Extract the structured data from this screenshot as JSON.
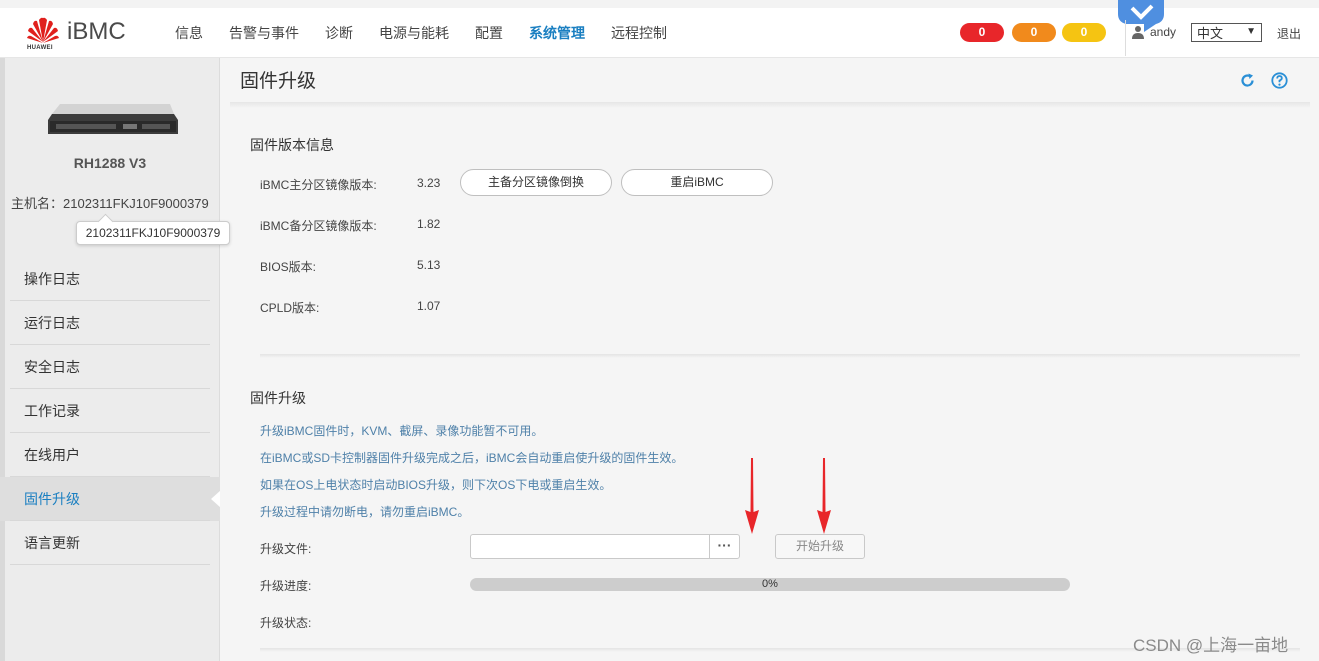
{
  "header": {
    "logo_sub": "HUAWEI",
    "brand": "iBMC",
    "nav": [
      "信息",
      "告警与事件",
      "诊断",
      "电源与能耗",
      "配置",
      "系统管理",
      "远程控制"
    ],
    "nav_active": "系统管理",
    "alarms": {
      "critical": "0",
      "major": "0",
      "minor": "0"
    },
    "alarm_colors": {
      "critical": "#e8262a",
      "major": "#f18a1c",
      "minor": "#f5c412"
    },
    "user": "andy",
    "language": "中文",
    "logout": "退出",
    "accent_color": "#1a7fc1"
  },
  "sidebar": {
    "model": "RH1288 V3",
    "hostname": "主机名：2102311FKJ10F9000379",
    "tooltip": "2102311FKJ10F9000379",
    "menu": [
      "操作日志",
      "运行日志",
      "安全日志",
      "工作记录",
      "在线用户",
      "固件升级",
      "语言更新"
    ],
    "menu_active": "固件升级"
  },
  "main": {
    "title": "固件升级",
    "version_section": {
      "title": "固件版本信息",
      "rows": [
        {
          "label": "iBMC主分区镜像版本:",
          "value": "3.23"
        },
        {
          "label": "iBMC备分区镜像版本:",
          "value": "1.82"
        },
        {
          "label": "BIOS版本:",
          "value": "5.13"
        },
        {
          "label": "CPLD版本:",
          "value": "1.07"
        }
      ],
      "swap_button": "主备分区镜像倒换",
      "restart_button": "重启iBMC"
    },
    "upgrade_section": {
      "title": "固件升级",
      "notes": [
        "升级iBMC固件时，KVM、截屏、录像功能暂不可用。",
        "在iBMC或SD卡控制器固件升级完成之后，iBMC会自动重启使升级的固件生效。",
        "如果在OS上电状态时启动BIOS升级，则下次OS下电或重启生效。",
        "升级过程中请勿断电，请勿重启iBMC。"
      ],
      "file_label": "升级文件:",
      "file_value": "",
      "browse_label": "···",
      "start_button": "开始升级",
      "progress_label": "升级进度:",
      "progress_percent": 0,
      "progress_text": "0%",
      "status_label": "升级状态:",
      "status_value": ""
    }
  },
  "watermark": "CSDN @上海一亩地"
}
